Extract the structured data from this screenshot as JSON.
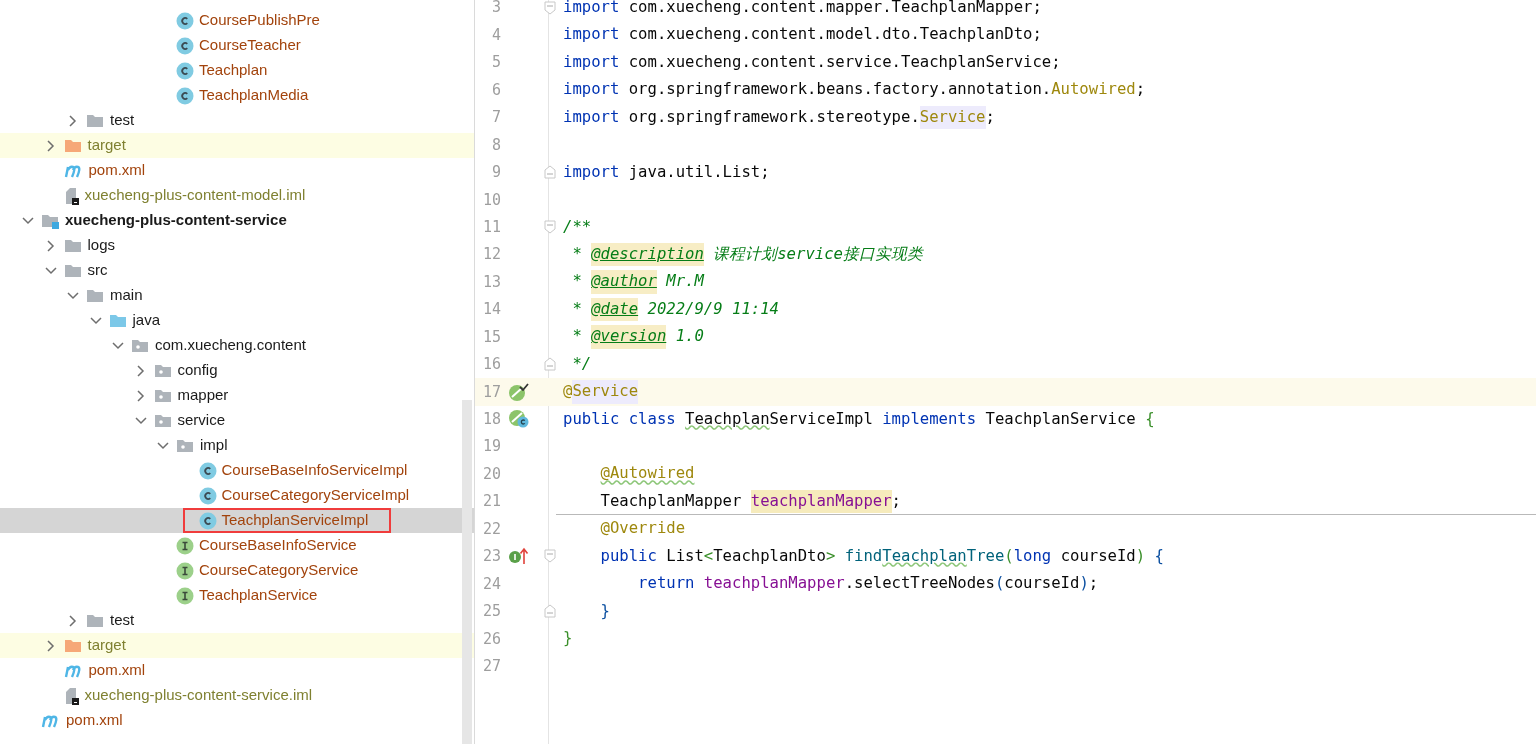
{
  "tree": [
    {
      "children": [
        {
          "children": [
            {
              "children": [
                {
                  "children": [
                    {
                      "children": [
                        {
                          "children": [
                            {
                              "label": "CoursePublishPre",
                              "kind": "class",
                              "color": "#a2430c",
                              "selected": false,
                              "outlined": false
                            },
                            {
                              "label": "CourseTeacher",
                              "kind": "class",
                              "color": "#a2430c",
                              "selected": false,
                              "outlined": false
                            },
                            {
                              "label": "Teachplan",
                              "kind": "class",
                              "color": "#a2430c",
                              "selected": false,
                              "outlined": false
                            },
                            {
                              "label": "TeachplanMedia",
                              "kind": "class",
                              "color": "#a2430c",
                              "selected": false,
                              "outlined": false
                            }
                          ]
                        }
                      ]
                    }
                  ]
                }
              ]
            },
            {
              "label": "test",
              "kind": "folder",
              "color": "#1a1a1a",
              "expanded": false,
              "selected": false,
              "outlined": false
            }
          ]
        },
        {
          "label": "target",
          "kind": "excluded_folder",
          "color": "#7f8030",
          "expanded": false,
          "selected": false,
          "outlined": false
        },
        {
          "label": "pom.xml",
          "kind": "maven",
          "color": "#a2430c",
          "selected": false,
          "outlined": false
        },
        {
          "label": "xuecheng-plus-content-model.iml",
          "kind": "iml",
          "color": "#7f8030",
          "selected": false,
          "outlined": false
        }
      ]
    },
    {
      "label": "xuecheng-plus-content-service",
      "kind": "module",
      "color": "#1a1a1a",
      "expanded": true,
      "selected": false,
      "outlined": false,
      "children": [
        {
          "label": "logs",
          "kind": "folder",
          "color": "#1a1a1a",
          "expanded": false,
          "selected": false,
          "outlined": false
        },
        {
          "label": "src",
          "kind": "folder",
          "color": "#1a1a1a",
          "expanded": true,
          "selected": false,
          "outlined": false,
          "children": [
            {
              "label": "main",
              "kind": "folder",
              "color": "#1a1a1a",
              "expanded": true,
              "selected": false,
              "outlined": false,
              "children": [
                {
                  "label": "java",
                  "kind": "source_root",
                  "color": "#1a1a1a",
                  "expanded": true,
                  "selected": false,
                  "outlined": false,
                  "children": [
                    {
                      "label": "com.xuecheng.content",
                      "kind": "package",
                      "color": "#1a1a1a",
                      "expanded": true,
                      "selected": false,
                      "outlined": false,
                      "children": [
                        {
                          "label": "config",
                          "kind": "package",
                          "color": "#1a1a1a",
                          "expanded": false,
                          "selected": false,
                          "outlined": false
                        },
                        {
                          "label": "mapper",
                          "kind": "package",
                          "color": "#1a1a1a",
                          "expanded": false,
                          "selected": false,
                          "outlined": false
                        },
                        {
                          "label": "service",
                          "kind": "package",
                          "color": "#1a1a1a",
                          "expanded": true,
                          "selected": false,
                          "outlined": false,
                          "children": [
                            {
                              "label": "impl",
                              "kind": "package",
                              "color": "#1a1a1a",
                              "expanded": true,
                              "selected": false,
                              "outlined": false,
                              "children": [
                                {
                                  "label": "CourseBaseInfoServiceImpl",
                                  "kind": "class",
                                  "color": "#a2430c",
                                  "selected": false,
                                  "outlined": false
                                },
                                {
                                  "label": "CourseCategoryServiceImpl",
                                  "kind": "class",
                                  "color": "#a2430c",
                                  "selected": false,
                                  "outlined": false
                                },
                                {
                                  "label": "TeachplanServiceImpl",
                                  "kind": "class",
                                  "color": "#a2430c",
                                  "selected": true,
                                  "outlined": true
                                }
                              ]
                            },
                            {
                              "label": "CourseBaseInfoService",
                              "kind": "interface",
                              "color": "#a2430c",
                              "selected": false,
                              "outlined": false
                            },
                            {
                              "label": "CourseCategoryService",
                              "kind": "interface",
                              "color": "#a2430c",
                              "selected": false,
                              "outlined": false
                            },
                            {
                              "label": "TeachplanService",
                              "kind": "interface",
                              "color": "#a2430c",
                              "selected": false,
                              "outlined": false
                            }
                          ]
                        }
                      ]
                    }
                  ]
                }
              ]
            },
            {
              "label": "test",
              "kind": "folder",
              "color": "#1a1a1a",
              "expanded": false,
              "selected": false,
              "outlined": false
            }
          ]
        },
        {
          "label": "target",
          "kind": "excluded_folder",
          "color": "#7f8030",
          "expanded": false,
          "selected": false,
          "outlined": false
        },
        {
          "label": "pom.xml",
          "kind": "maven",
          "color": "#a2430c",
          "selected": false,
          "outlined": false
        },
        {
          "label": "xuecheng-plus-content-service.iml",
          "kind": "iml",
          "color": "#7f8030",
          "selected": false,
          "outlined": false
        }
      ]
    },
    {
      "label": "pom.xml",
      "kind": "maven",
      "color": "#a2430c",
      "selected": false,
      "outlined": false
    }
  ],
  "editor": {
    "lines": [
      {
        "number": "3",
        "fold_start": true,
        "tokens": [
          {
            "text": "import",
            "kind": "keyword"
          },
          {
            "text": " com.xuecheng.content.mapper.TeachplanMapper;",
            "kind": "plain"
          }
        ]
      },
      {
        "number": "4",
        "tokens": [
          {
            "text": "import",
            "kind": "keyword"
          },
          {
            "text": " com.xuecheng.content.model.dto.TeachplanDto;",
            "kind": "plain"
          }
        ]
      },
      {
        "number": "5",
        "tokens": [
          {
            "text": "import",
            "kind": "keyword"
          },
          {
            "text": " com.xuecheng.content.service.TeachplanService;",
            "kind": "plain"
          }
        ]
      },
      {
        "number": "6",
        "tokens": [
          {
            "text": "import",
            "kind": "keyword"
          },
          {
            "text": " org.springframework.beans.factory.annotation.",
            "kind": "plain"
          },
          {
            "text": "Autowired",
            "kind": "annotation"
          },
          {
            "text": ";",
            "kind": "plain"
          }
        ]
      },
      {
        "number": "7",
        "tokens": [
          {
            "text": "import",
            "kind": "keyword"
          },
          {
            "text": " org.springframework.stereotype.",
            "kind": "plain"
          },
          {
            "text": "Service",
            "kind": "annotation",
            "usage_highlight": true
          },
          {
            "text": ";",
            "kind": "plain"
          }
        ]
      },
      {
        "number": "8"
      },
      {
        "number": "9",
        "fold_end": true,
        "tokens": [
          {
            "text": "import",
            "kind": "keyword"
          },
          {
            "text": " java.util.List;",
            "kind": "plain"
          }
        ]
      },
      {
        "number": "10"
      },
      {
        "number": "11",
        "fold_start": true,
        "tokens": [
          {
            "text": "/**",
            "kind": "doc"
          }
        ]
      },
      {
        "number": "12",
        "tokens": [
          {
            "text": " * ",
            "kind": "doc"
          },
          {
            "text": "@description",
            "kind": "doctag"
          },
          {
            "text": " 课程计划service接口实现类",
            "kind": "doc"
          }
        ]
      },
      {
        "number": "13",
        "tokens": [
          {
            "text": " * ",
            "kind": "doc"
          },
          {
            "text": "@author",
            "kind": "doctag"
          },
          {
            "text": " Mr.M",
            "kind": "doc"
          }
        ]
      },
      {
        "number": "14",
        "tokens": [
          {
            "text": " * ",
            "kind": "doc"
          },
          {
            "text": "@date",
            "kind": "doctag"
          },
          {
            "text": " 2022/9/9 11:14",
            "kind": "doc"
          }
        ]
      },
      {
        "number": "15",
        "tokens": [
          {
            "text": " * ",
            "kind": "doc"
          },
          {
            "text": "@version",
            "kind": "doctag"
          },
          {
            "text": " 1.0",
            "kind": "doc"
          }
        ]
      },
      {
        "number": "16",
        "fold_end": true,
        "tokens": [
          {
            "text": " */",
            "kind": "doc"
          }
        ]
      },
      {
        "number": "17",
        "caret": true,
        "gutter_icon": {
          "kind": "bean"
        },
        "tokens": [
          {
            "text": "@",
            "kind": "annotation"
          },
          {
            "text": "Service",
            "kind": "annotation",
            "usage_highlight": true
          }
        ]
      },
      {
        "number": "18",
        "gutter_icon": {
          "kind": "bean_class"
        },
        "tokens": [
          {
            "text": "public class ",
            "kind": "keyword"
          },
          {
            "text": "Teachplan",
            "kind": "plain",
            "typo": true
          },
          {
            "text": "ServiceImpl ",
            "kind": "plain"
          },
          {
            "text": "implements ",
            "kind": "keyword"
          },
          {
            "text": "TeachplanService ",
            "kind": "plain"
          },
          {
            "text": "{",
            "kind": "bracket1"
          }
        ]
      },
      {
        "number": "19"
      },
      {
        "number": "20",
        "tokens": [
          {
            "text": "    @Autowired",
            "kind": "annotation",
            "typo": true
          }
        ]
      },
      {
        "number": "21",
        "separator_below": true,
        "tokens": [
          {
            "text": "    TeachplanMapper ",
            "kind": "plain"
          },
          {
            "text": "teachplanMapper",
            "kind": "field",
            "write_highlight": true
          },
          {
            "text": ";",
            "kind": "plain"
          }
        ]
      },
      {
        "number": "22",
        "tokens": [
          {
            "text": "    @Override",
            "kind": "annotation"
          }
        ]
      },
      {
        "number": "23",
        "fold_start": true,
        "gutter_icon": {
          "kind": "implements"
        },
        "tokens": [
          {
            "text": "    public ",
            "kind": "keyword"
          },
          {
            "text": "List",
            "kind": "plain"
          },
          {
            "text": "<",
            "kind": "bracket1"
          },
          {
            "text": "TeachplanDto",
            "kind": "plain"
          },
          {
            "text": "> ",
            "kind": "bracket1"
          },
          {
            "text": "find",
            "kind": "method"
          },
          {
            "text": "Teachplan",
            "kind": "method",
            "typo": true
          },
          {
            "text": "Tree",
            "kind": "method"
          },
          {
            "text": "(",
            "kind": "bracket1"
          },
          {
            "text": "long ",
            "kind": "keyword"
          },
          {
            "text": "courseId",
            "kind": "plain"
          },
          {
            "text": ") ",
            "kind": "bracket1"
          },
          {
            "text": "{",
            "kind": "bracket2"
          }
        ]
      },
      {
        "number": "24",
        "tokens": [
          {
            "text": "        return ",
            "kind": "keyword"
          },
          {
            "text": "teachplanMapper",
            "kind": "field"
          },
          {
            "text": ".selectTreeNodes",
            "kind": "plain"
          },
          {
            "text": "(",
            "kind": "bracket2"
          },
          {
            "text": "courseId",
            "kind": "plain"
          },
          {
            "text": ")",
            "kind": "bracket2"
          },
          {
            "text": ";",
            "kind": "plain"
          }
        ]
      },
      {
        "number": "25",
        "fold_end": true,
        "tokens": [
          {
            "text": "    }",
            "kind": "bracket2"
          }
        ]
      },
      {
        "number": "26",
        "tokens": [
          {
            "text": "}",
            "kind": "bracket1"
          }
        ]
      },
      {
        "number": "27"
      }
    ]
  }
}
